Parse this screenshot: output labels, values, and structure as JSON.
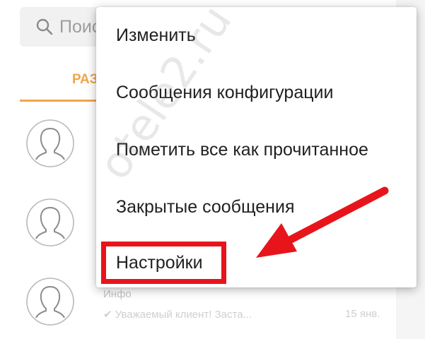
{
  "search": {
    "placeholder_visible": "Поис",
    "icon": "search-icon"
  },
  "tabs": [
    {
      "label": "РАЗ",
      "active": true,
      "accent": "#f0a64a"
    }
  ],
  "contacts": [
    {
      "avatar": "avatar-placeholder-icon",
      "name": "",
      "preview": "",
      "time": ""
    },
    {
      "avatar": "avatar-placeholder-icon",
      "name": "",
      "preview": "",
      "time": ""
    },
    {
      "avatar": "avatar-placeholder-icon",
      "name": "Инфо",
      "preview": "✔ Уважаемый клиент! Заста...",
      "time": "15 янв."
    }
  ],
  "menu": {
    "items": [
      {
        "label": "Изменить"
      },
      {
        "label": "Сообщения конфигурации"
      },
      {
        "label": "Пометить все как прочитанное"
      },
      {
        "label": "Закрытые сообщения"
      },
      {
        "label": "Настройки",
        "highlighted": true
      }
    ]
  },
  "annotation": {
    "highlight_color": "#e8141c",
    "arrow_color": "#e8141c",
    "arrow_target": "Настройки"
  },
  "watermark": {
    "text": "otele2.ru"
  }
}
